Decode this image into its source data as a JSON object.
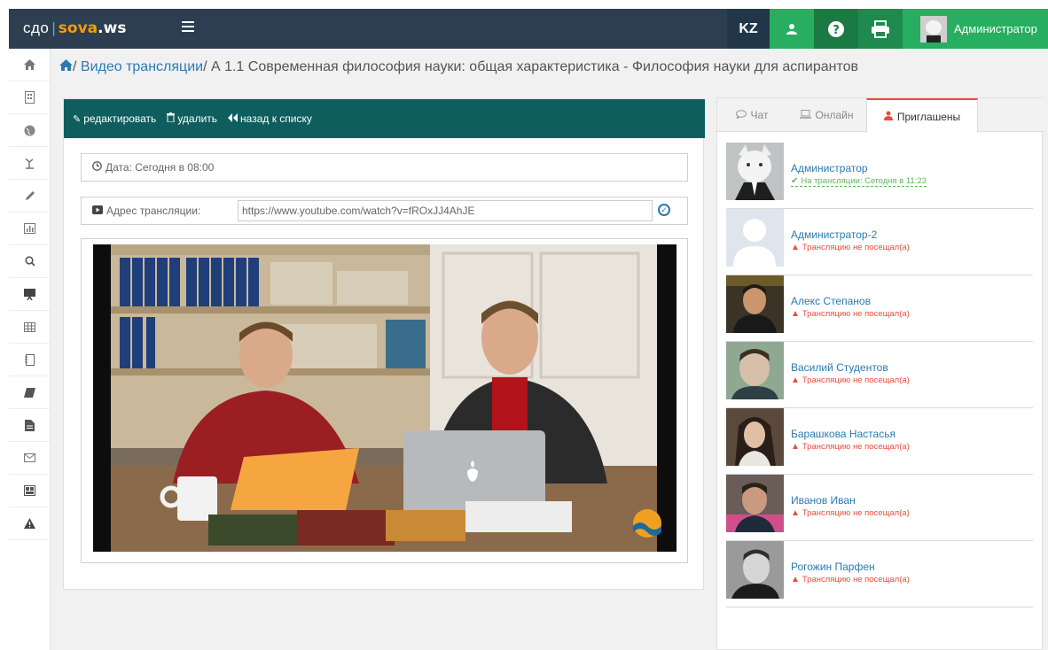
{
  "brand": {
    "sdo": "сдо",
    "sova": "sova",
    "ws": ".ws"
  },
  "topbar": {
    "lang": "KZ",
    "user_name": "Администратор"
  },
  "icons": {
    "user": "user-icon",
    "help": "help-icon",
    "print": "print-icon",
    "menu": "menu-icon"
  },
  "breadcrumb": {
    "section": "Видео трансляции",
    "current": "А 1.1 Современная философия науки: общая характеристика - Философия науки для аспирантов"
  },
  "panel": {
    "edit_label": "редактировать",
    "delete_label": "удалить",
    "back_label": "назад к списку",
    "date_label": "Дата: Сегодня в 08:00",
    "url_label": "Адрес трансляции:",
    "url_value": "https://www.youtube.com/watch?v=fROxJJ4AhJE"
  },
  "tabs": [
    {
      "label": "Чат"
    },
    {
      "label": "Онлайн"
    },
    {
      "label": "Приглашены"
    }
  ],
  "participants": [
    {
      "name": "Администратор",
      "status": "На трансляции: Сегодня в 11:23",
      "attended": true
    },
    {
      "name": "Администратор-2",
      "status": "Трансляцию не посещал(а)",
      "attended": false
    },
    {
      "name": "Алекс Степанов",
      "status": "Трансляцию не посещал(а)",
      "attended": false
    },
    {
      "name": "Василий Студентов",
      "status": "Трансляцию не посещал(а)",
      "attended": false
    },
    {
      "name": "Барашкова Настасья",
      "status": "Трансляцию не посещал(а)",
      "attended": false
    },
    {
      "name": "Иванов Иван",
      "status": "Трансляцию не посещал(а)",
      "attended": false
    },
    {
      "name": "Рогожин Парфен",
      "status": "Трансляцию не посещал(а)",
      "attended": false
    }
  ],
  "colors": {
    "topbar": "#2c3e50",
    "accent_green": "#27ae60",
    "panel_head": "#0e5e5e",
    "link": "#2a7ab0",
    "warn": "#e74c3c"
  }
}
